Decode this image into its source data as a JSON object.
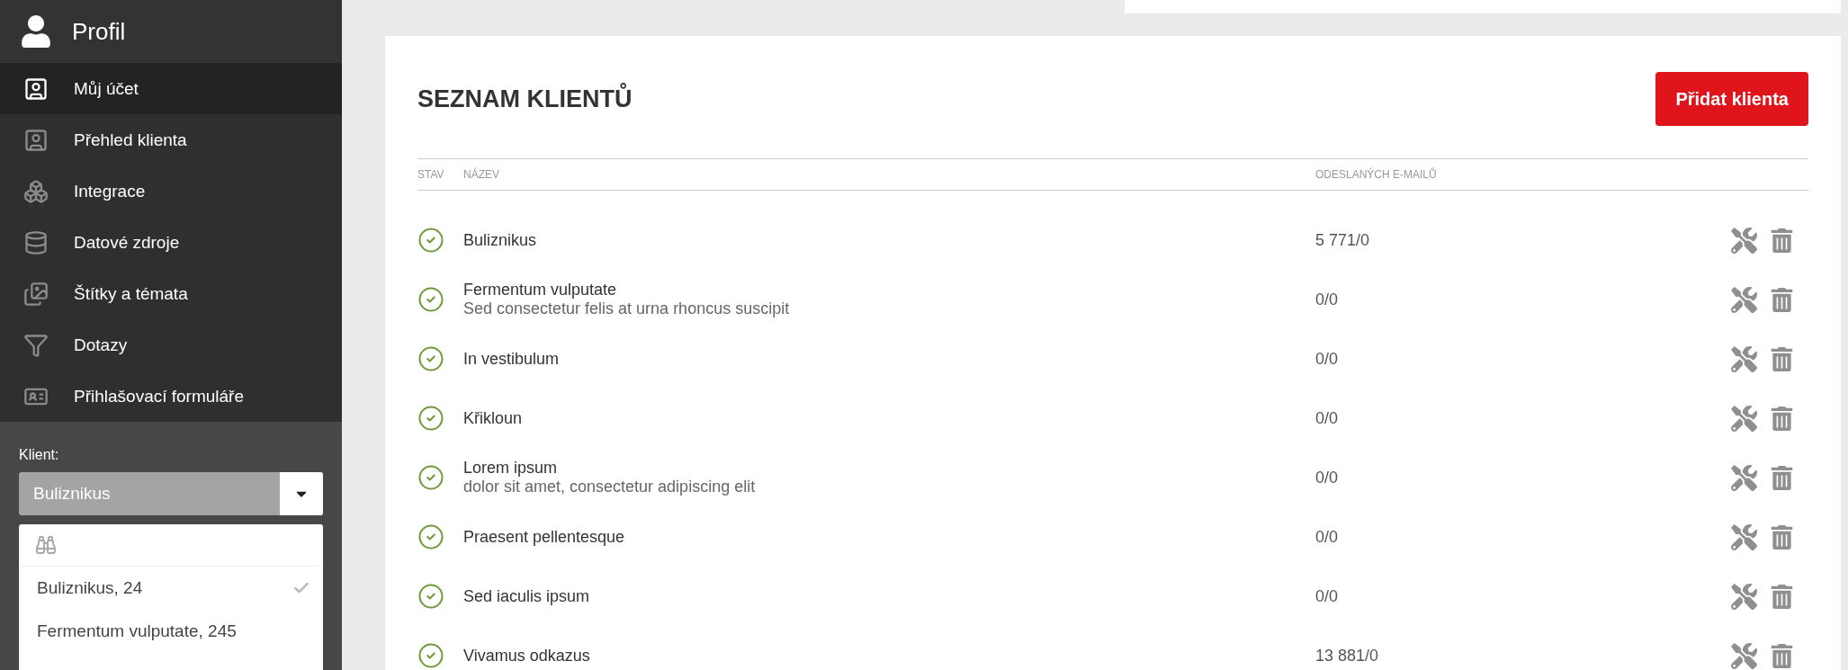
{
  "sidebar": {
    "title": "Profil",
    "items": [
      {
        "label": "Můj účet",
        "selected": true
      },
      {
        "label": "Přehled klienta",
        "selected": false
      },
      {
        "label": "Integrace",
        "selected": false
      },
      {
        "label": "Datové zdroje",
        "selected": false
      },
      {
        "label": "Štítky a témata",
        "selected": false
      },
      {
        "label": "Dotazy",
        "selected": false
      },
      {
        "label": "Přihlašovací formuláře",
        "selected": false
      }
    ],
    "client_label": "Klient:",
    "client_select": {
      "value": "Buliznikus"
    },
    "dropdown": {
      "options": [
        {
          "label": "Buliznikus, 24",
          "selected": true
        },
        {
          "label": "Fermentum vulputate, 245",
          "selected": false
        }
      ]
    }
  },
  "main": {
    "title": "SEZNAM KLIENTŮ",
    "add_button": "Přidat klienta",
    "table": {
      "columns": [
        "STAV",
        "NÁZEV",
        "ODESLANÝCH E-MAILŮ"
      ],
      "rows": [
        {
          "active": true,
          "name": "Buliznikus",
          "emails": "5 771/0"
        },
        {
          "active": true,
          "name": "Fermentum vulputate",
          "description": "Sed consectetur felis at urna rhoncus suscipit",
          "emails": "0/0"
        },
        {
          "active": true,
          "name": "In vestibulum",
          "emails": "0/0"
        },
        {
          "active": true,
          "name": "Křikloun",
          "emails": "0/0"
        },
        {
          "active": true,
          "name": "Lorem ipsum",
          "description": "dolor sit amet, consectetur adipiscing elit",
          "emails": "0/0"
        },
        {
          "active": true,
          "name": "Praesent pellentesque",
          "emails": "0/0"
        },
        {
          "active": true,
          "name": "Sed iaculis ipsum",
          "emails": "0/0"
        },
        {
          "active": true,
          "name": "Vivamus odkazus",
          "emails": "13 881/0"
        }
      ]
    }
  }
}
